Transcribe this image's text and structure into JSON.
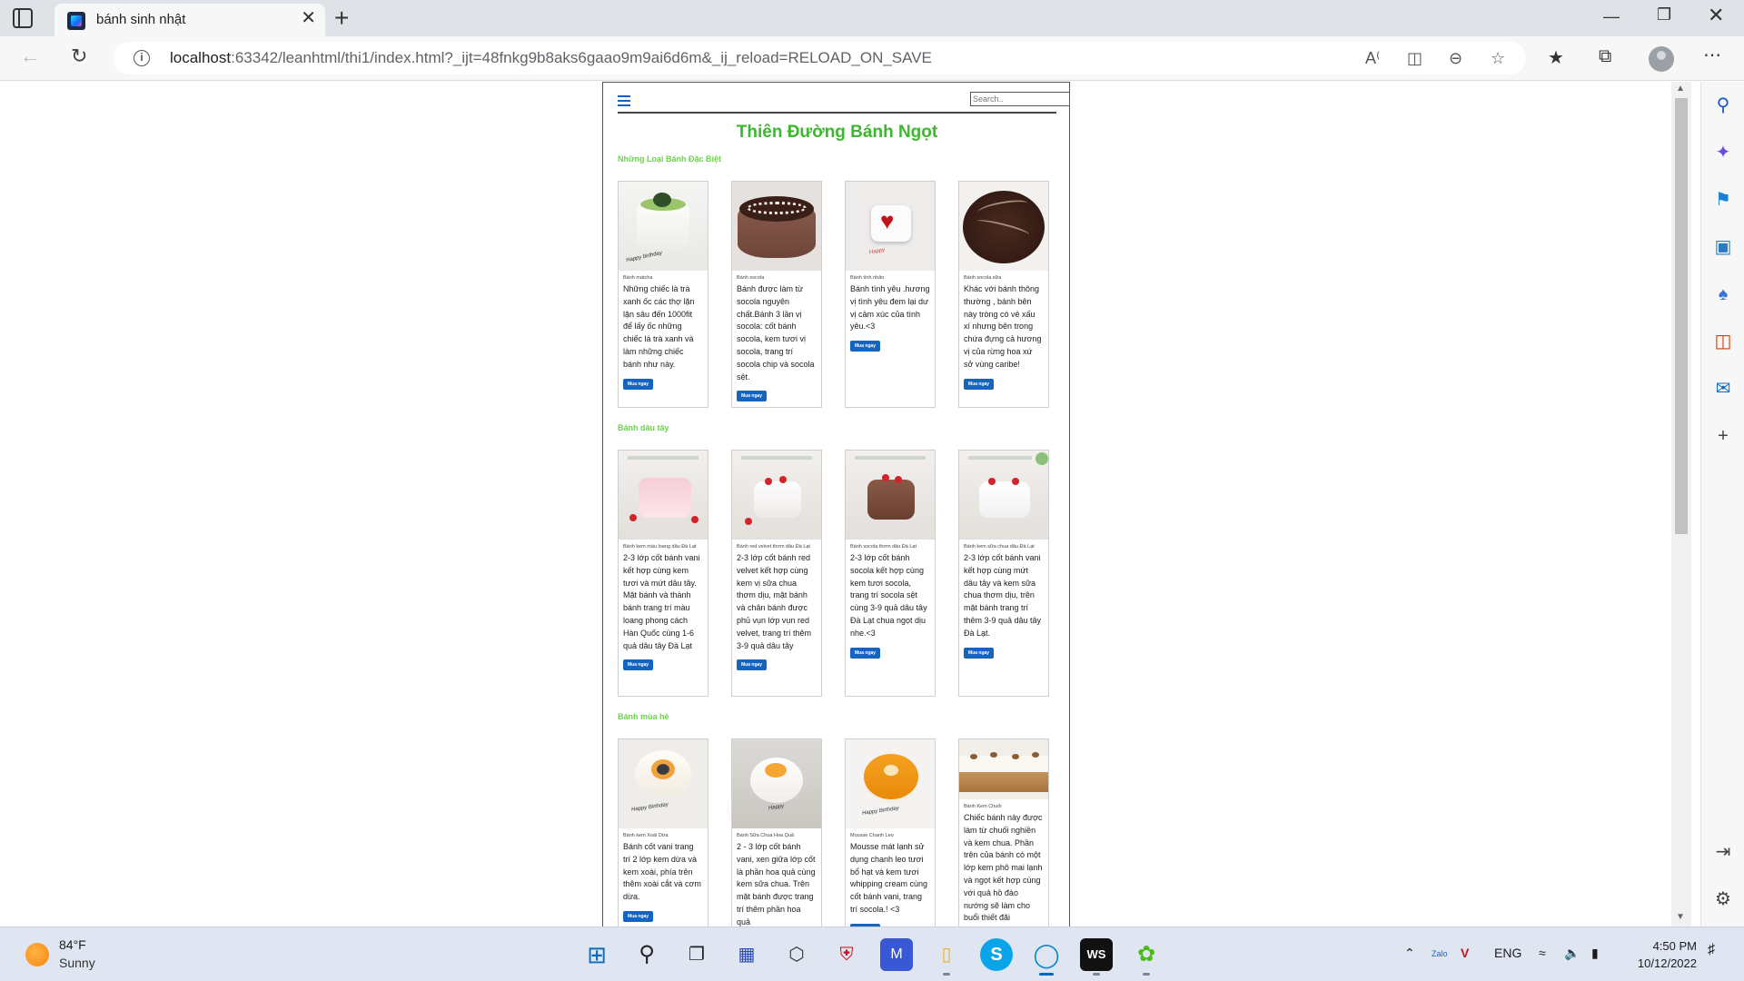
{
  "browser": {
    "tab_title": "bánh sinh nhật",
    "url_host": "localhost",
    "url_rest": ":63342/leanhtml/thi1/index.html?_ijt=48fnkg9b8aks6gaao9m9ai6d6m&_ij_reload=RELOAD_ON_SAVE",
    "new_tab_symbol": "+",
    "close_tab_symbol": "✕"
  },
  "page": {
    "search_placeholder": "Search..",
    "site_title": "Thiên Đường Bánh Ngọt",
    "buy_label": "Mua ngay",
    "sections": [
      {
        "title": "Những Loại Bánh Đặc Biệt",
        "cards": [
          {
            "name": "Bánh matcha",
            "desc": "Những chiếc là trà xanh ốc các thợ lặn lặn sâu đến 1000fit để lấy ốc những chiếc lá trà xanh và làm những chiếc bánh như này.",
            "image": "matcha-cake"
          },
          {
            "name": "Bánh socola",
            "desc": "Bánh được làm từ socola nguyên chất.Bánh 3 lần vị socola: cốt bánh socola, kem tươi vị socola, trang trí socola chip và socola sệt.",
            "image": "chocolate-cake"
          },
          {
            "name": "Bánh tình nhân",
            "desc": "Bánh tình yêu .hương vị tình yêu đem lại dư vị cảm xúc của tình yêu.<3",
            "image": "heart-cake"
          },
          {
            "name": "Bánh socola sữa",
            "desc": "Khác với bánh thông thường , bánh bên này tròng có vẻ xấu xí nhưng bên trong chứa đựng cả hương vị của rừng hoa xứ sở vùng caribe!",
            "image": "milk-chocolate-cake"
          }
        ]
      },
      {
        "title": "Bánh dâu tây",
        "cards": [
          {
            "name": "Bánh kem màu loang dâu Đà Lạt",
            "desc": "2-3 lớp cốt bánh vani kết hợp cùng kem tươi và mứt dâu tây. Mặt bánh và thành bánh trang trí màu loang phong cách Hàn Quốc cùng 1-6 quả dâu tây Đà Lạt",
            "image": "strawberry-swirl-cake"
          },
          {
            "name": "Bánh red velvet thơm dâu Đà Lạt",
            "desc": "2-3 lớp cốt bánh red velvet kết hợp cùng kem vị sữa chua thơm dịu, mặt bánh và chân bánh được phủ vụn lớp vụn red velvet, trang trí thêm 3-9 quả dâu tây",
            "image": "red-velvet-cake"
          },
          {
            "name": "Bánh socola thơm dâu Đà Lạt",
            "desc": "2-3 lớp cốt bánh socola kết hợp cùng kem tươi socola, trang trí socola sệt cùng 3-9 quả dâu tây Đà Lạt chua ngọt dịu nhe.<3",
            "image": "chocolate-strawberry-cake"
          },
          {
            "name": "Bánh kem sữa chua dâu Đà Lạt",
            "desc": "2-3 lớp cốt bánh vani kết hợp cùng mứt dâu tây và kem sữa chua thơm dịu, trên mặt bánh trang trí thêm 3-9 quả dâu tây Đà Lạt.",
            "image": "yogurt-strawberry-cake"
          }
        ]
      },
      {
        "title": "Bánh mùa hè",
        "cards": [
          {
            "name": "Bánh kem Xoài Dừa",
            "desc": "Bánh cốt vani trang trí 2 lớp kem dừa và kem xoài, phía trên thêm xoài cắt và cơm dừa.",
            "image": "mango-coconut-cake"
          },
          {
            "name": "Bánh Sữa Chua Hoa Quả",
            "desc": "2 - 3 lớp cốt bánh vani, xen giữa lớp cốt là phần hoa quả cùng kem sữa chua. Trên mặt bánh được trang trí thêm phần hoa quả",
            "image": "fruit-yogurt-cake"
          },
          {
            "name": "Mousse Chanh Leo",
            "desc": "Mousse mát lạnh sử dụng chanh leo tươi bổ hạt và kem tươi whipping cream cùng cốt bánh vani, trang trí socola.! <3",
            "image": "passionfruit-mousse"
          },
          {
            "name": "Bánh Kem Chuối",
            "desc": "Chiếc bánh này được làm từ chuối nghiền và kem chua. Phần trên của bánh có một lớp kem phô mai lạnh và ngọt kết hợp cùng với quả hồ đào nướng sẽ làm cho buổi thiết đãi",
            "image": "banana-cake"
          }
        ]
      }
    ]
  },
  "taskbar": {
    "weather_temp": "84°F",
    "weather_condition": "Sunny",
    "language": "ENG",
    "time": "4:50 PM",
    "date": "10/12/2022"
  }
}
